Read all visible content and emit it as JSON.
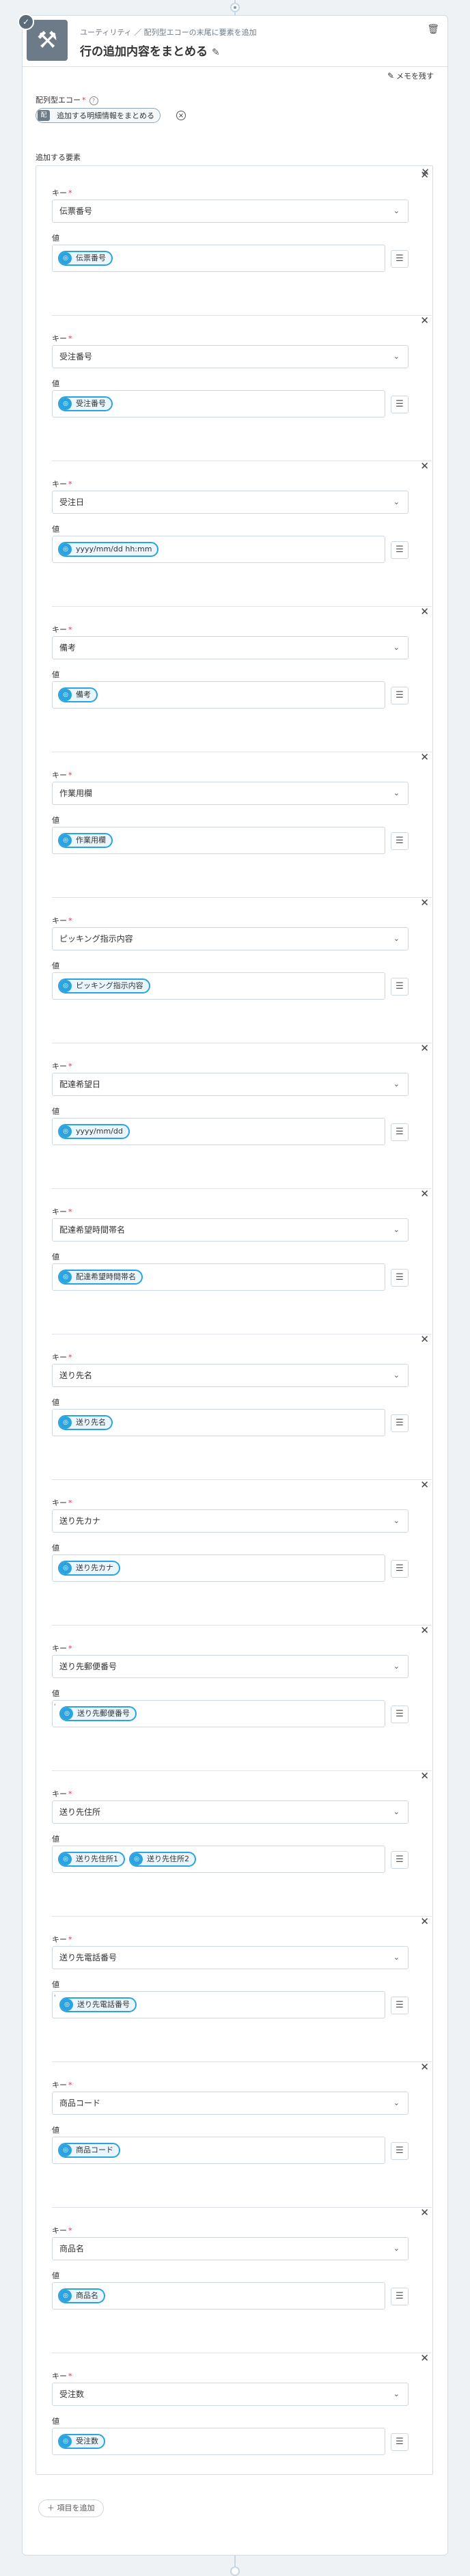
{
  "step": {
    "breadcrumb": "ユーティリティ ／ 配列型エコーの末尾に要素を追加",
    "title": "行の追加内容をまとめる",
    "memo_label": "メモを残す"
  },
  "array_field": {
    "label": "配列型エコー",
    "chip_icon": "配",
    "chip_label": "追加する明細情報をまとめる"
  },
  "elements_label": "追加する要素",
  "key_label": "キー",
  "value_label": "値",
  "pill_icon": "◎",
  "items": [
    {
      "key": "伝票番号",
      "values": [
        "伝票番号"
      ]
    },
    {
      "key": "受注番号",
      "values": [
        "受注番号"
      ]
    },
    {
      "key": "受注日",
      "values": [
        "yyyy/mm/dd hh:mm"
      ]
    },
    {
      "key": "備考",
      "values": [
        "備考"
      ]
    },
    {
      "key": "作業用欄",
      "values": [
        "作業用欄"
      ]
    },
    {
      "key": "ピッキング指示内容",
      "values": [
        "ピッキング指示内容"
      ]
    },
    {
      "key": "配達希望日",
      "values": [
        "yyyy/mm/dd"
      ]
    },
    {
      "key": "配達希望時間帯名",
      "values": [
        "配達希望時間帯名"
      ]
    },
    {
      "key": "送り先名",
      "values": [
        "送り先名"
      ]
    },
    {
      "key": "送り先カナ",
      "values": [
        "送り先カナ"
      ]
    },
    {
      "key": "送り先郵便番号",
      "values": [
        "送り先郵便番号"
      ],
      "prefix": "'"
    },
    {
      "key": "送り先住所",
      "values": [
        "送り先住所1",
        "送り先住所2"
      ]
    },
    {
      "key": "送り先電話番号",
      "values": [
        "送り先電話番号"
      ],
      "prefix": "'"
    },
    {
      "key": "商品コード",
      "values": [
        "商品コード"
      ]
    },
    {
      "key": "商品名",
      "values": [
        "商品名"
      ]
    },
    {
      "key": "受注数",
      "values": [
        "受注数"
      ]
    }
  ],
  "add_item_label": "項目を追加"
}
